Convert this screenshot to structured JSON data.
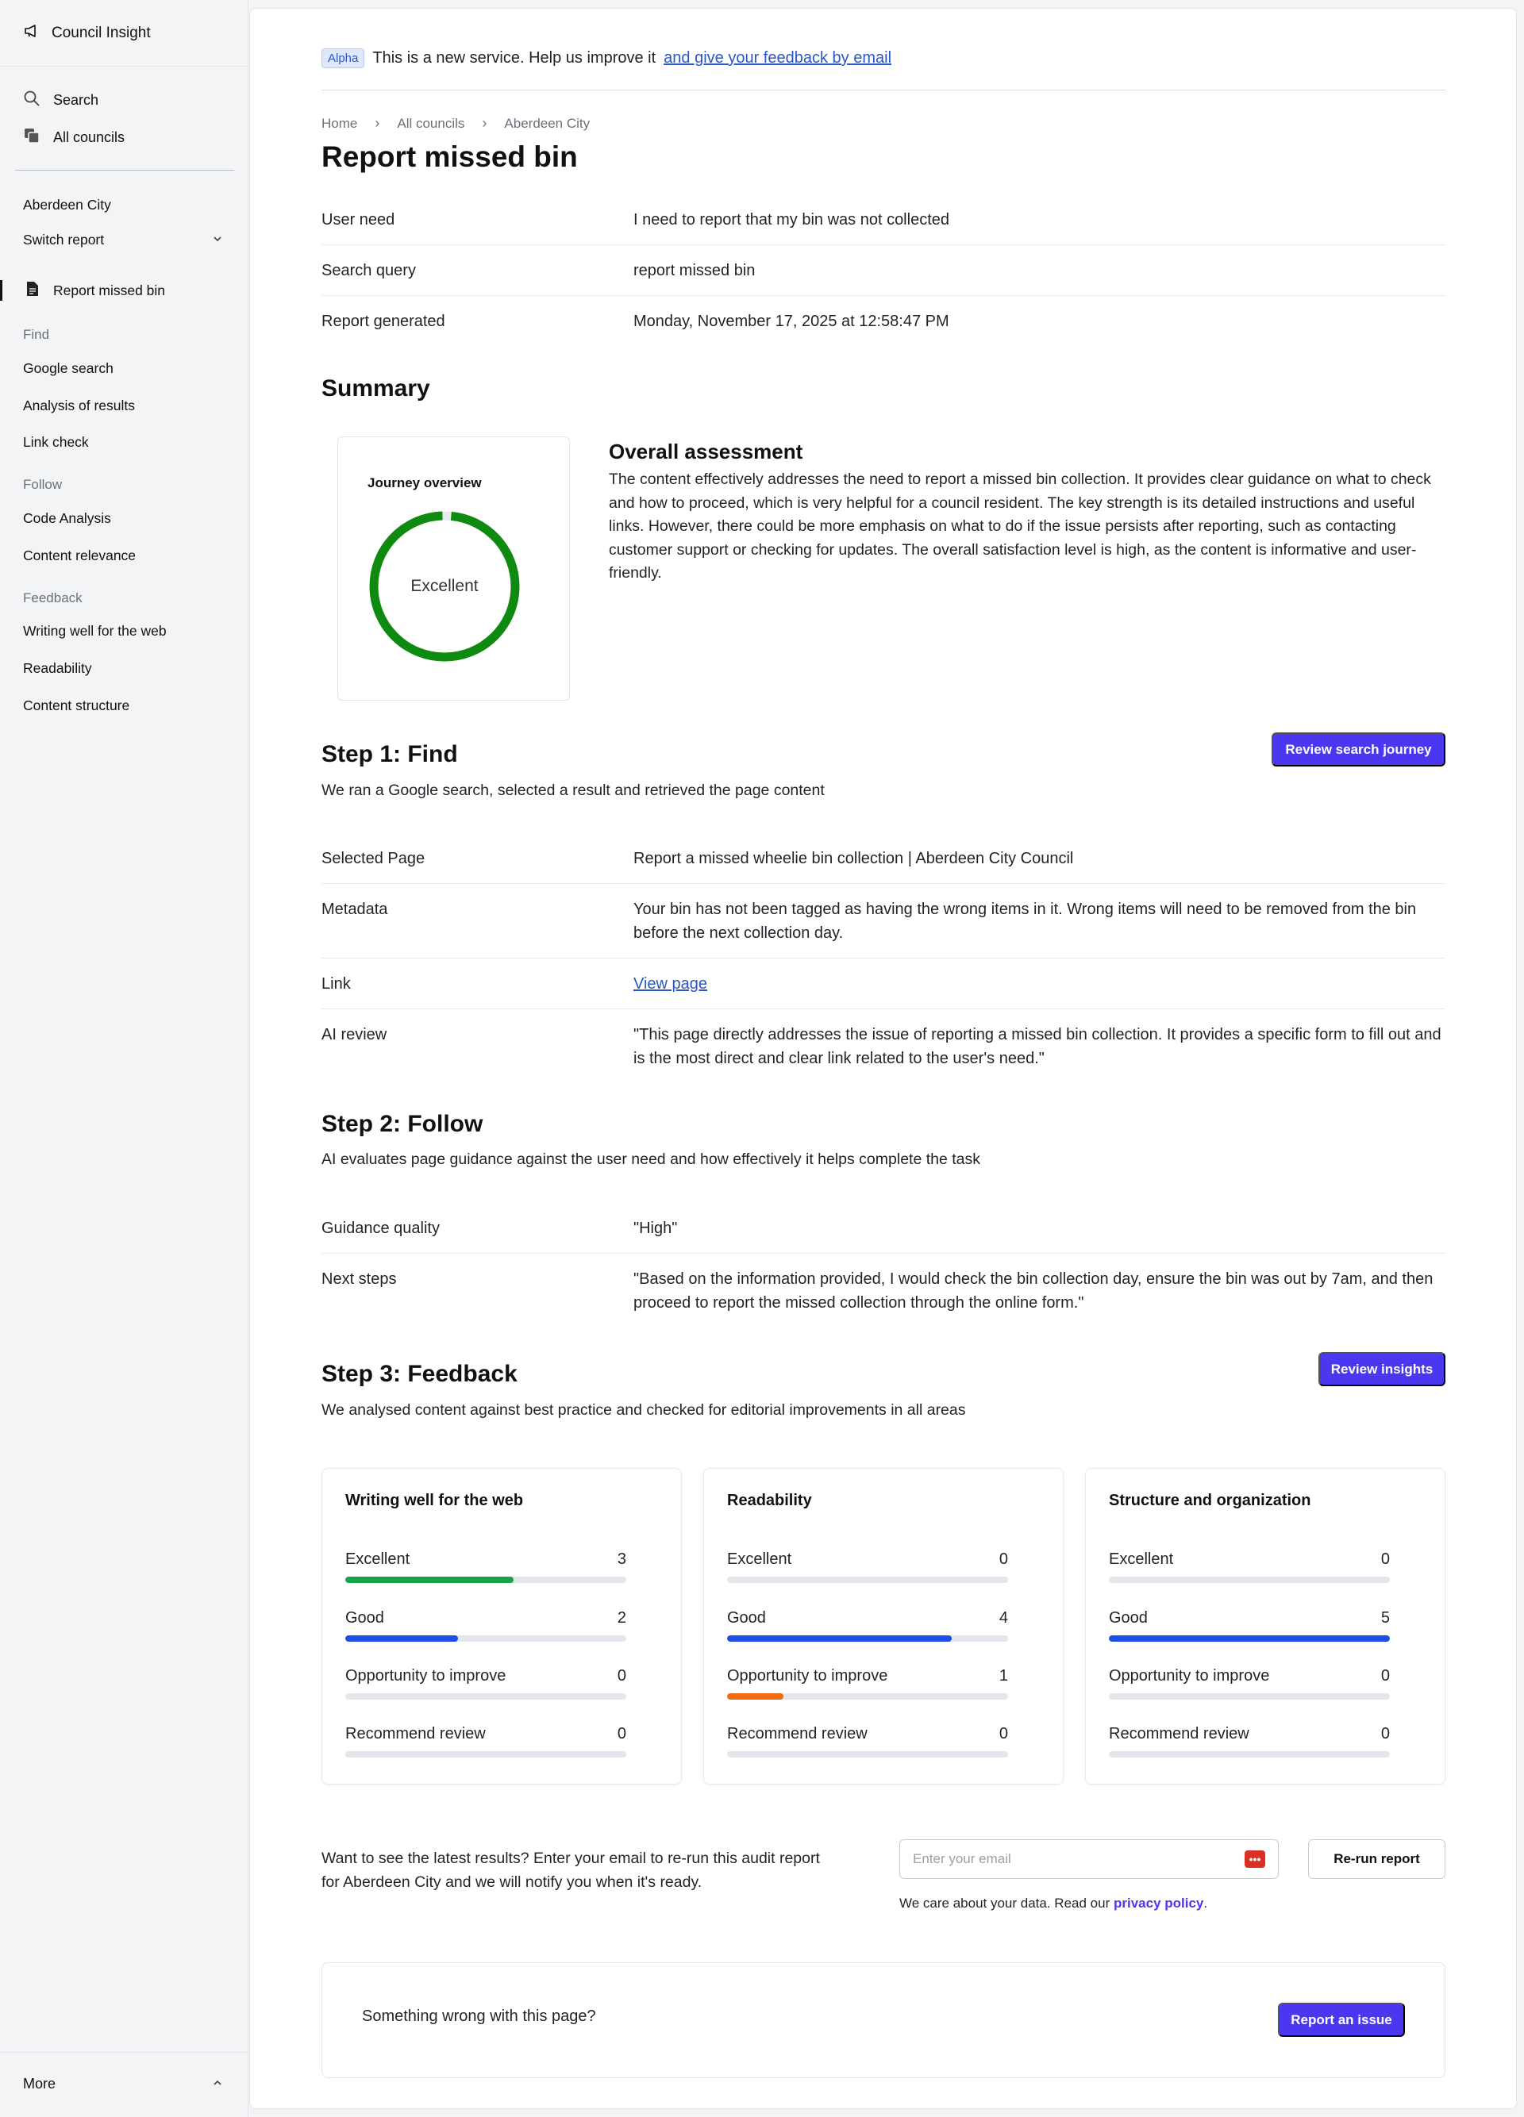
{
  "sidebar": {
    "brand": "Council Insight",
    "nav": {
      "search": "Search",
      "all_councils": "All councils"
    },
    "council": "Aberdeen City",
    "switch_report": "Switch report",
    "active_report": "Report missed bin",
    "groups": [
      {
        "label": "Find",
        "items": [
          "Google search",
          "Analysis of results",
          "Link check"
        ]
      },
      {
        "label": "Follow",
        "items": [
          "Code Analysis",
          "Content relevance"
        ]
      },
      {
        "label": "Feedback",
        "items": [
          "Writing well for the web",
          "Readability",
          "Content structure"
        ]
      }
    ],
    "more": "More"
  },
  "banner": {
    "badge": "Alpha",
    "text": "This is a new service. Help us improve it",
    "link": "and give your feedback by email"
  },
  "breadcrumb": [
    "Home",
    "All councils",
    "Aberdeen City"
  ],
  "title": "Report missed bin",
  "details": [
    {
      "key": "User need",
      "value": "I need to report that my bin was not collected"
    },
    {
      "key": "Search query",
      "value": "report missed bin"
    },
    {
      "key": "Report generated",
      "value": "Monday, November 17, 2025 at 12:58:47 PM"
    }
  ],
  "summary": {
    "heading": "Summary",
    "journey_title": "Journey overview",
    "journey_rating": "Excellent",
    "journey_score": 0.98,
    "ring_color": "#0f8a10",
    "assessment_title": "Overall assessment",
    "assessment_text": "The content effectively addresses the need to report a missed bin collection. It provides clear guidance on what to check and how to proceed, which is very helpful for a council resident. The key strength is its detailed instructions and useful links. However, there could be more emphasis on what to do if the issue persists after reporting, such as contacting customer support or checking for updates. The overall satisfaction level is high, as the content is informative and user-friendly."
  },
  "step1": {
    "heading": "Step 1: Find",
    "lead": "We ran a Google search, selected a result and retrieved the page content",
    "button": "Review search journey",
    "rows": [
      {
        "key": "Selected Page",
        "value": "Report a missed wheelie bin collection | Aberdeen City Council"
      },
      {
        "key": "Metadata",
        "value": "Your bin has not been tagged as having the wrong items in it. Wrong items will need to be removed from the bin before the next collection day."
      },
      {
        "key": "Link",
        "value": "View page"
      },
      {
        "key": "AI review",
        "value": "\"This page directly addresses the issue of reporting a missed bin collection. It provides a specific form to fill out and is the most direct and clear link related to the user's need.\""
      }
    ]
  },
  "step2": {
    "heading": "Step 2: Follow",
    "lead": "AI evaluates page guidance against the user need and how effectively it helps complete the task",
    "rows": [
      {
        "key": "Guidance quality",
        "value": "\"High\""
      },
      {
        "key": "Next steps",
        "value": "\"Based on the information provided, I would check the bin collection day, ensure the bin was out by 7am, and then proceed to report the missed collection through the online form.\""
      }
    ]
  },
  "step3": {
    "heading": "Step 3: Feedback",
    "lead": "We analysed content against best practice and checked for editorial improvements in all areas",
    "button": "Review insights",
    "cards": [
      {
        "title": "Writing well for the web",
        "metrics": [
          {
            "label": "Excellent",
            "count": 3,
            "color": "#16a34a"
          },
          {
            "label": "Good",
            "count": 2,
            "color": "#1d4ee8"
          },
          {
            "label": "Opportunity to improve",
            "count": 0,
            "color": "#f26b0f"
          },
          {
            "label": "Recommend review",
            "count": 0,
            "color": "#9aa0a6"
          }
        ]
      },
      {
        "title": "Readability",
        "metrics": [
          {
            "label": "Excellent",
            "count": 0,
            "color": "#16a34a"
          },
          {
            "label": "Good",
            "count": 4,
            "color": "#1d4ee8"
          },
          {
            "label": "Opportunity to improve",
            "count": 1,
            "color": "#f26b0f"
          },
          {
            "label": "Recommend review",
            "count": 0,
            "color": "#9aa0a6"
          }
        ]
      },
      {
        "title": "Structure and organization",
        "metrics": [
          {
            "label": "Excellent",
            "count": 0,
            "color": "#16a34a"
          },
          {
            "label": "Good",
            "count": 5,
            "color": "#1d4ee8"
          },
          {
            "label": "Opportunity to improve",
            "count": 0,
            "color": "#f26b0f"
          },
          {
            "label": "Recommend review",
            "count": 0,
            "color": "#9aa0a6"
          }
        ]
      }
    ]
  },
  "rerun": {
    "text": "Want to see the latest results? Enter your email to re-run this audit report for Aberdeen City and we will notify you when it's ready.",
    "placeholder": "Enter your email",
    "button": "Re-run report",
    "privacy_text": "We care about your data. Read our",
    "privacy_link": "privacy policy",
    "privacy_end": "."
  },
  "issue": {
    "text": "Something wrong with this page?",
    "button": "Report an issue"
  }
}
